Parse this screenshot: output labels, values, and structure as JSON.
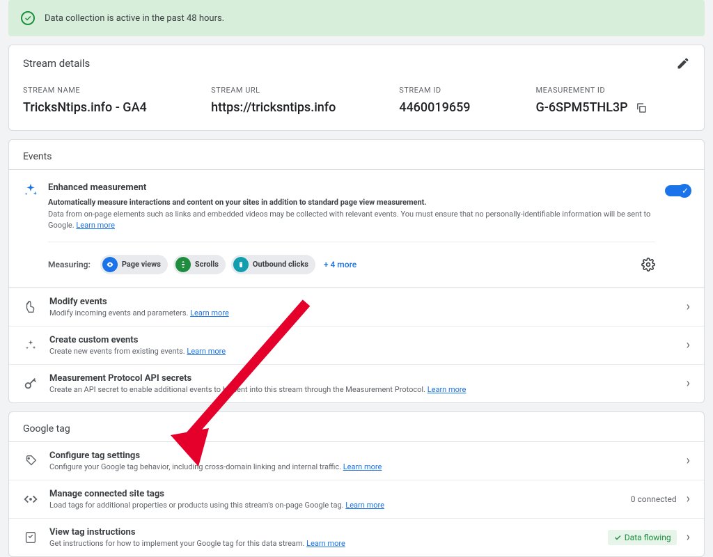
{
  "banner": {
    "message": "Data collection is active in the past 48 hours."
  },
  "stream": {
    "title": "Stream details",
    "fields": {
      "name_label": "STREAM NAME",
      "name_value": "TricksNtips.info - GA4",
      "url_label": "STREAM URL",
      "url_value": "https://tricksntips.info",
      "id_label": "STREAM ID",
      "id_value": "4460019659",
      "measurement_label": "MEASUREMENT ID",
      "measurement_value": "G-6SPM5THL3P"
    }
  },
  "events": {
    "title": "Events",
    "enhanced": {
      "title": "Enhanced measurement",
      "desc_bold": "Automatically measure interactions and content on your sites in addition to standard page view measurement.",
      "desc": "Data from on-page elements such as links and embedded videos may be collected with relevant events. You must ensure that no personally-identifiable information will be sent to Google. ",
      "learn_more": "Learn more",
      "measuring_label": "Measuring:",
      "chips": {
        "page_views": "Page views",
        "scrolls": "Scrolls",
        "outbound": "Outbound clicks"
      },
      "more": "+ 4 more"
    },
    "modify": {
      "title": "Modify events",
      "desc_pre": "Modify incoming events and parameters. ",
      "learn_more": "Learn more"
    },
    "create": {
      "title": "Create custom events",
      "desc_pre": "Create new events from existing events. ",
      "learn_more": "Learn more"
    },
    "protocol": {
      "title": "Measurement Protocol API secrets",
      "desc_pre": "Create an API secret to enable additional events to be sent into this stream through the Measurement Protocol. ",
      "learn_more": "Learn more"
    }
  },
  "google_tag": {
    "title": "Google tag",
    "configure": {
      "title": "Configure tag settings",
      "desc_pre": "Configure your Google tag behavior, including cross-domain linking and internal traffic. ",
      "learn_more": "Learn more"
    },
    "manage": {
      "title": "Manage connected site tags",
      "desc_pre": "Load tags for additional properties or products using this stream's on-page Google tag. ",
      "learn_more": "Learn more",
      "connected": "0 connected"
    },
    "instructions": {
      "title": "View tag instructions",
      "desc_pre": "Get instructions for how to implement your Google tag for this data stream. ",
      "learn_more": "Learn more",
      "flowing": "Data flowing"
    }
  }
}
